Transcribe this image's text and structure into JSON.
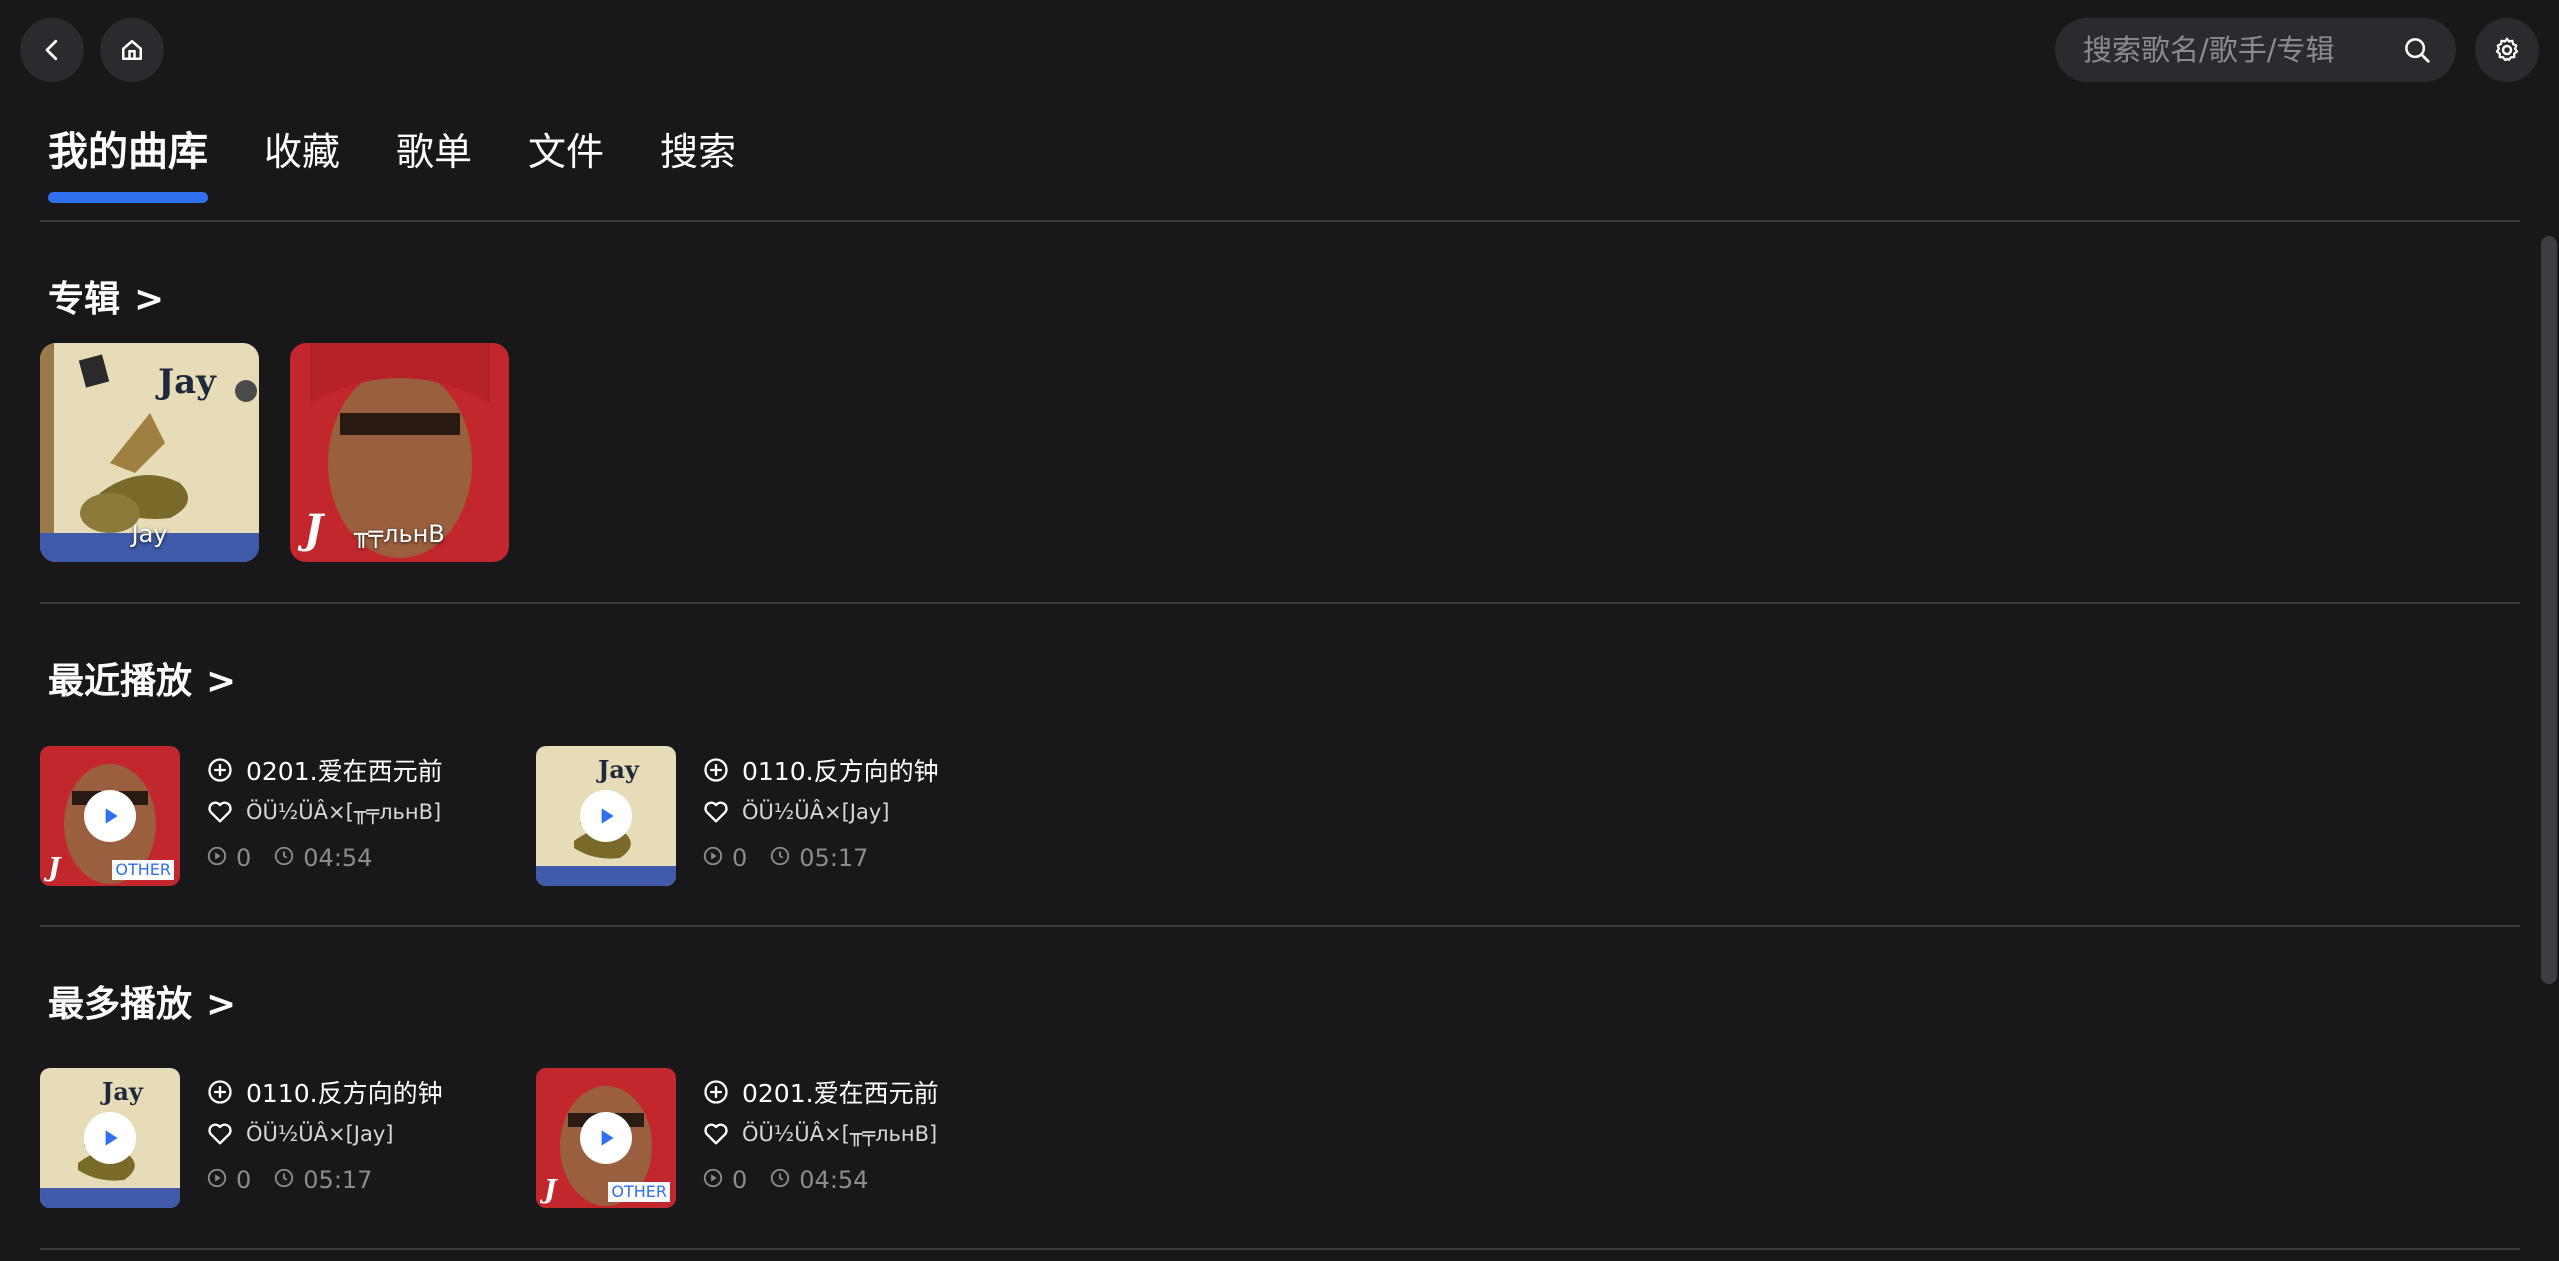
{
  "search": {
    "placeholder": "搜索歌名/歌手/专辑"
  },
  "tabs": [
    {
      "label": "我的曲库",
      "active": true
    },
    {
      "label": "收藏"
    },
    {
      "label": "歌单"
    },
    {
      "label": "文件"
    },
    {
      "label": "搜索"
    }
  ],
  "sections": {
    "albums": {
      "title": "专辑",
      "chevron": ">"
    },
    "recent": {
      "title": "最近播放",
      "chevron": ">"
    },
    "most": {
      "title": "最多播放",
      "chevron": ">"
    }
  },
  "albums": [
    {
      "caption": "Jay"
    },
    {
      "caption": "╥╤льнВ"
    }
  ],
  "recent": [
    {
      "title": "0201.爱在西元前",
      "artist": "ÖÜ½ÜÂ×[╥╤льнВ]",
      "plays": "0",
      "duration": "04:54",
      "badge": "OTHER"
    },
    {
      "title": "0110.反方向的钟",
      "artist": "ÖÜ½ÜÂ×[Jay]",
      "plays": "0",
      "duration": "05:17"
    }
  ],
  "most": [
    {
      "title": "0110.反方向的钟",
      "artist": "ÖÜ½ÜÂ×[Jay]",
      "plays": "0",
      "duration": "05:17"
    },
    {
      "title": "0201.爱在西元前",
      "artist": "ÖÜ½ÜÂ×[╥╤льнВ]",
      "plays": "0",
      "duration": "04:54",
      "badge": "OTHER"
    }
  ],
  "colors": {
    "background": "#18181b",
    "accent": "#2f6ff0",
    "surface": "#2b2b2f",
    "muted": "#8b8b90"
  }
}
